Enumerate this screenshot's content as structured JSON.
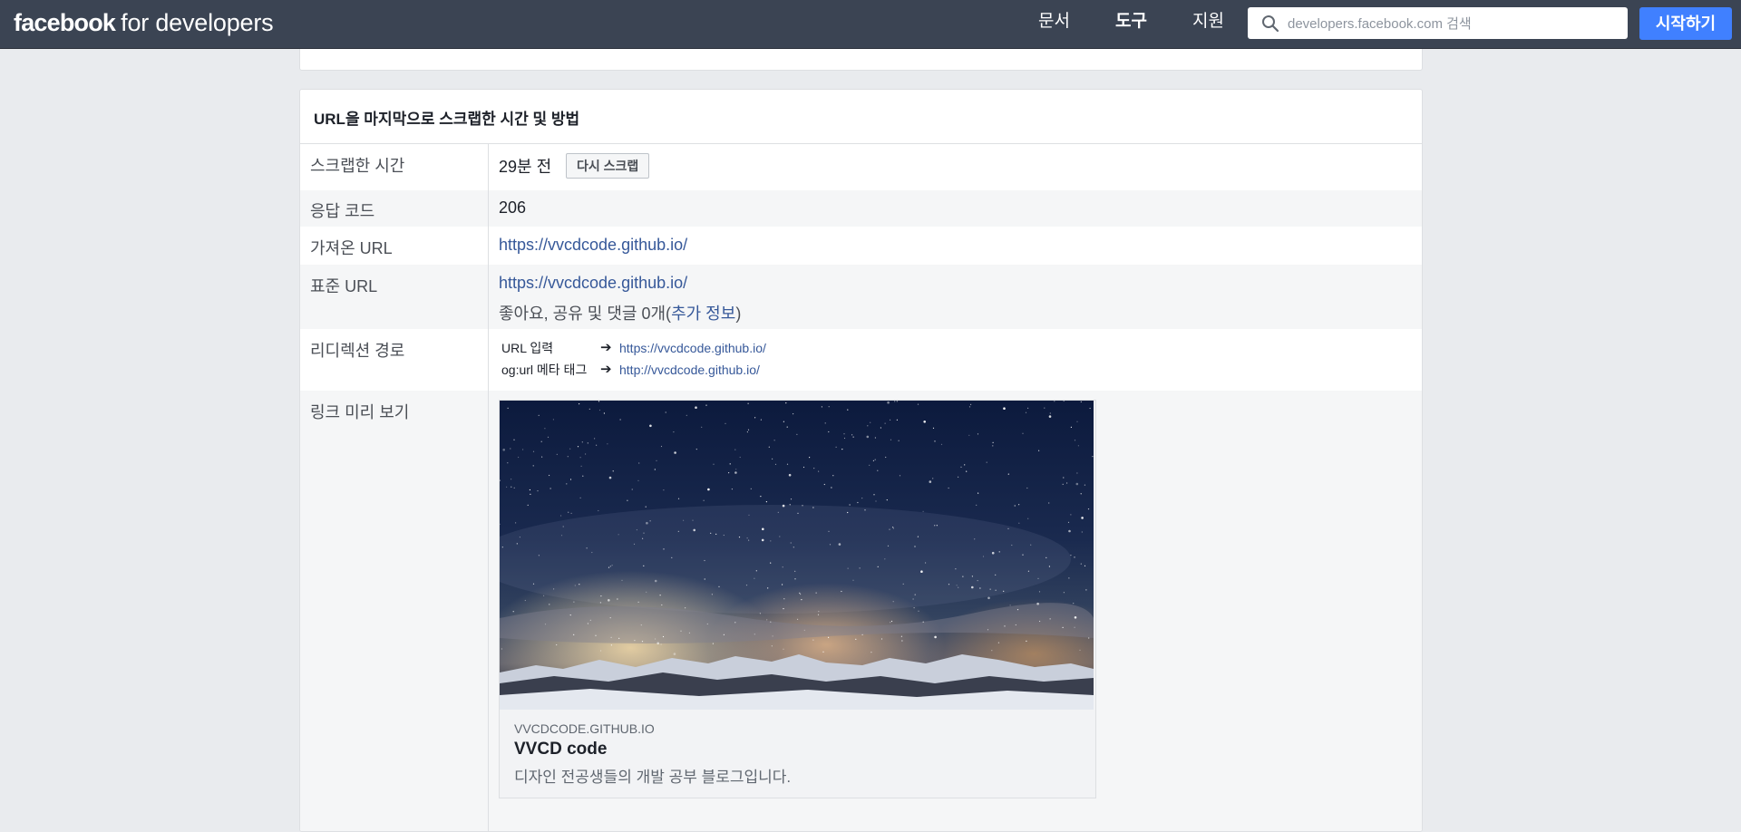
{
  "nav": {
    "brand_bold": "facebook",
    "brand_light": "for developers",
    "items": [
      {
        "label": "문서",
        "active": false
      },
      {
        "label": "도구",
        "active": true
      },
      {
        "label": "지원",
        "active": false
      }
    ],
    "search_placeholder": "developers.facebook.com 검색",
    "cta_label": "시작하기"
  },
  "panel": {
    "title": "URL을 마지막으로 스크랩한 시간 및 방법",
    "rows": {
      "scraped": {
        "label": "스크랩한 시간",
        "value": "29분 전",
        "button": "다시 스크랩"
      },
      "response": {
        "label": "응답 코드",
        "value": "206"
      },
      "fetched": {
        "label": "가져온 URL",
        "value": "https://vvcdcode.github.io/"
      },
      "canonical": {
        "label": "표준 URL",
        "value": "https://vvcdcode.github.io/",
        "stats_prefix": "좋아요, 공유 및 댓글 0개(",
        "stats_link": "추가 정보",
        "stats_suffix": ")"
      },
      "redirect": {
        "label": "리디렉션 경로",
        "entries": [
          {
            "key": "URL 입력",
            "arrow": "➔",
            "url": "https://vvcdcode.github.io/"
          },
          {
            "key": "og:url 메타 태그",
            "arrow": "➔",
            "url": "http://vvcdcode.github.io/"
          }
        ]
      },
      "preview": {
        "label": "링크 미리 보기",
        "domain": "VVCDCODE.GITHUB.IO",
        "title": "VVCD code",
        "description": "디자인 전공생들의 개발 공부 블로그입니다."
      }
    }
  },
  "colors": {
    "nav_bg": "#3b4453",
    "cta": "#4080ff",
    "link": "#365899",
    "page_bg": "#e9ebee"
  }
}
